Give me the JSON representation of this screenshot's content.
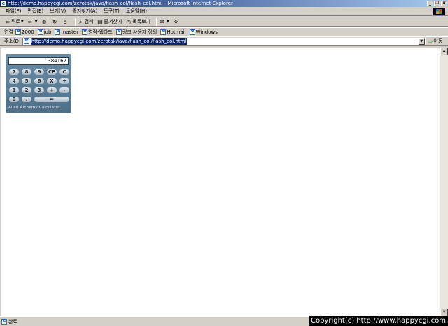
{
  "window": {
    "title": "http://demo.happycgi.com/zerotak/java/flash_col/flash_col.html - Microsoft Internet Explorer",
    "controls": {
      "minimize": "_",
      "restore": "❐",
      "close": "x"
    }
  },
  "menu": {
    "items": [
      "파일(F)",
      "편집(E)",
      "보기(V)",
      "즐겨찾기(A)",
      "도구(T)",
      "도움말(H)"
    ]
  },
  "toolbar": {
    "back": "뒤로",
    "search": "검색",
    "favorites": "즐겨찾기",
    "history": "목록보기"
  },
  "links": {
    "label": "연결",
    "items": [
      "2000",
      "job",
      "master",
      "영락-웹하드",
      "링크 사용자 정의",
      "Hotmail",
      "Windows"
    ]
  },
  "address": {
    "label": "주소(D)",
    "url": "http://demo.happycgi.com/zerotak/java/flash_col/flash_col.html",
    "go_label": "이동"
  },
  "calculator": {
    "display": "384162",
    "keys": [
      [
        "7",
        "8",
        "9",
        "CE",
        "C"
      ],
      [
        "4",
        "5",
        "6",
        "X",
        "÷"
      ],
      [
        "1",
        "2",
        "3",
        "+",
        "-"
      ],
      [
        "0",
        ".",
        "="
      ]
    ],
    "brand": "Alien Alchemy Calculator"
  },
  "status": {
    "text": "완료",
    "copyright": "Copyright(c) http://www.happycgi.com"
  },
  "icons": {
    "back": "back-arrow-icon",
    "forward": "forward-arrow-icon",
    "stop": "stop-icon",
    "refresh": "refresh-icon",
    "home": "home-icon",
    "search": "search-icon",
    "favorites": "favorites-icon",
    "history": "history-icon",
    "mail": "mail-icon",
    "print": "print-icon"
  }
}
